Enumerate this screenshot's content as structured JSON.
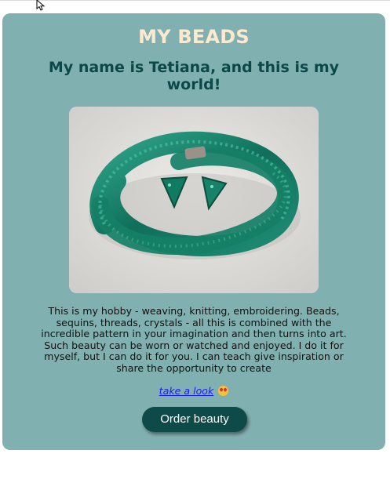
{
  "header": {
    "title": "MY BEADS",
    "subtitle": "My name is Tetiana, and this is my world!"
  },
  "main": {
    "description": "This is my hobby - weaving, knitting, embroidering. Beads, sequins, threads, crystals - all this is combined with the incredible pattern in your imagination and then turns into art. Such beauty can be worn or watched and enjoyed. I do it for myself, but I can do it for you. I can teach give inspiration or share the opportunity to create",
    "link_text": "take a look",
    "link_emoji": "heart-eyes-emoji-icon",
    "button_label": "Order beauty"
  },
  "colors": {
    "card_bg": "#80b1b0",
    "title": "#fbe9d0",
    "subtitle": "#0d4848",
    "button_bg": "#0d4a48",
    "link": "#1a1aff"
  }
}
